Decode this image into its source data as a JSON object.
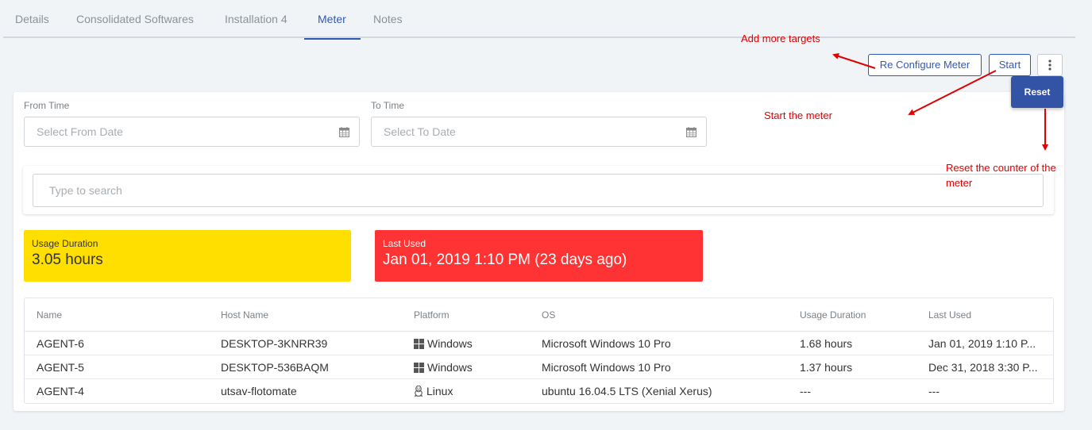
{
  "tabs": [
    {
      "label": "Details"
    },
    {
      "label": "Consolidated Softwares"
    },
    {
      "label": "Installation 4"
    },
    {
      "label": "Meter",
      "active": true
    },
    {
      "label": "Notes"
    }
  ],
  "toolbar": {
    "reconfigure_label": "Re Configure Meter",
    "start_label": "Start",
    "more_icon": "vertical-ellipsis-icon",
    "reset_label": "Reset"
  },
  "filters": {
    "from_label": "From Time",
    "from_placeholder": "Select From Date",
    "to_label": "To Time",
    "to_placeholder": "Select To Date",
    "calendar_icon": "calendar-icon"
  },
  "search": {
    "placeholder": "Type to search"
  },
  "stats": {
    "usage": {
      "label": "Usage Duration",
      "value": "3.05 hours",
      "color": "#ffdf00"
    },
    "last_used": {
      "label": "Last Used",
      "value": "Jan 01, 2019 1:10 PM (23 days ago)",
      "color": "#ff3333"
    }
  },
  "table": {
    "columns": [
      "Name",
      "Host Name",
      "Platform",
      "OS",
      "Usage Duration",
      "Last Used"
    ],
    "rows": [
      {
        "name": "AGENT-6",
        "host": "DESKTOP-3KNRR39",
        "platform": "Windows",
        "platform_icon": "windows-icon",
        "os": "Microsoft Windows 10 Pro",
        "usage": "1.68 hours",
        "last_used": "Jan 01, 2019 1:10 P..."
      },
      {
        "name": "AGENT-5",
        "host": "DESKTOP-536BAQM",
        "platform": "Windows",
        "platform_icon": "windows-icon",
        "os": "Microsoft Windows 10 Pro",
        "usage": "1.37 hours",
        "last_used": "Dec 31, 2018 3:30 P..."
      },
      {
        "name": "AGENT-4",
        "host": "utsav-flotomate",
        "platform": "Linux",
        "platform_icon": "linux-icon",
        "os": "ubuntu 16.04.5 LTS (Xenial Xerus)",
        "usage": "---",
        "last_used": "---"
      }
    ]
  },
  "annotations": {
    "add_targets": "Add more targets",
    "start_meter": "Start the meter",
    "reset_line1": "Reset the counter of the",
    "reset_line2": "meter",
    "color": "#e00000"
  },
  "colors": {
    "accent": "#2f59b8",
    "reset_bg": "#3353a6"
  }
}
